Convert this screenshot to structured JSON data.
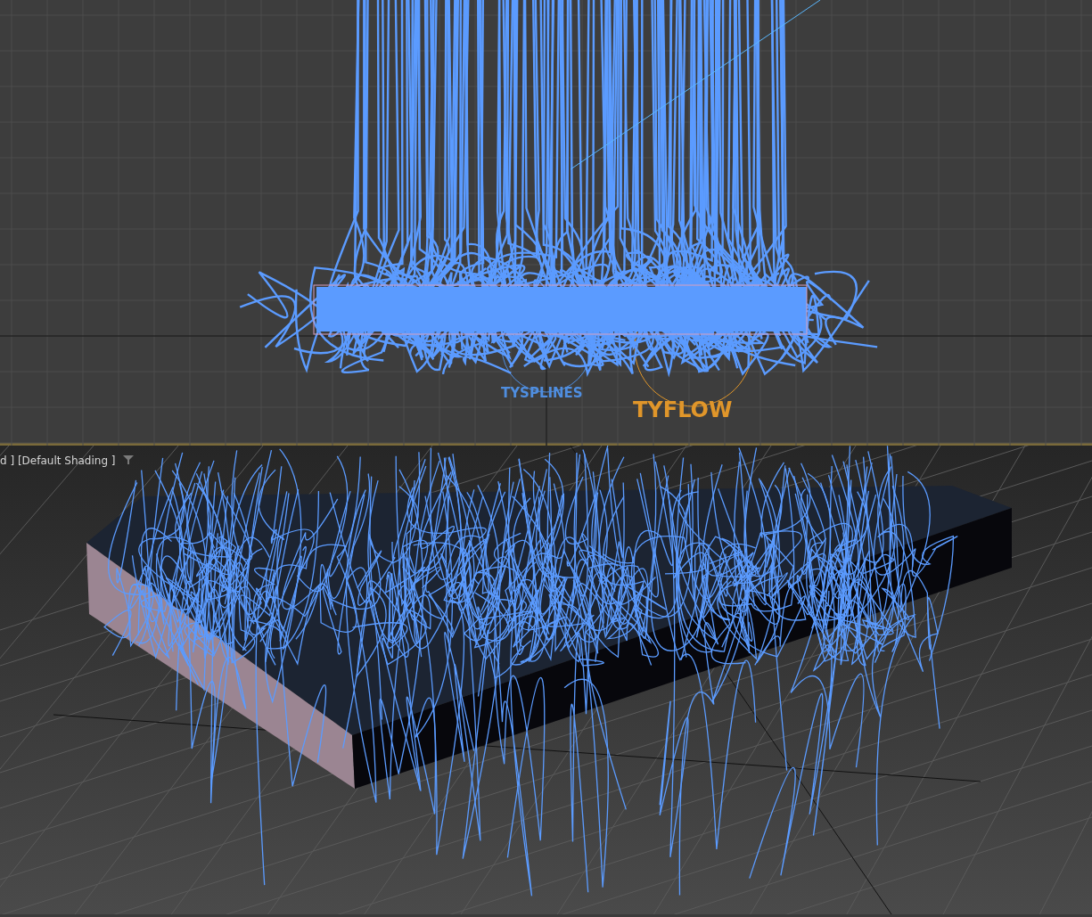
{
  "viewports": [
    {
      "kind": "front",
      "icon_labels": [
        {
          "text": "TYSPLINES",
          "color": "#4f8ee0"
        },
        {
          "text": "TYFLOW",
          "color": "#e0962a"
        }
      ]
    },
    {
      "kind": "perspective",
      "label": "d ] [Default Shading ]"
    }
  ]
}
